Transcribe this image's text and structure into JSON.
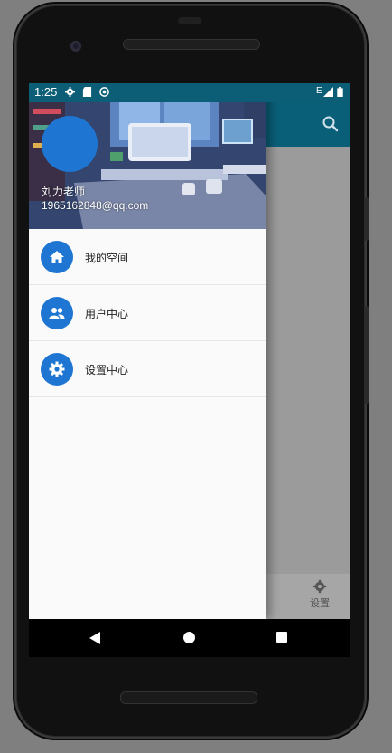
{
  "status_bar": {
    "time": "1:25",
    "network": "E",
    "icons": [
      "gear-icon",
      "sd-card-icon",
      "sync-icon",
      "signal-icon",
      "battery-icon"
    ]
  },
  "app_bar": {
    "action_icon": "search-icon"
  },
  "drawer": {
    "account_name": "刘力老师",
    "account_email": "1965162848@qq.com",
    "items": [
      {
        "label": "我的空间",
        "icon": "home-icon"
      },
      {
        "label": "用户中心",
        "icon": "people-icon"
      },
      {
        "label": "设置中心",
        "icon": "settings-icon"
      }
    ]
  },
  "bottom_nav": {
    "settings_label": "设置"
  },
  "colors": {
    "primary": "#0a5f78",
    "accent": "#1e75d2",
    "drawer_bg": "#fafafa"
  }
}
